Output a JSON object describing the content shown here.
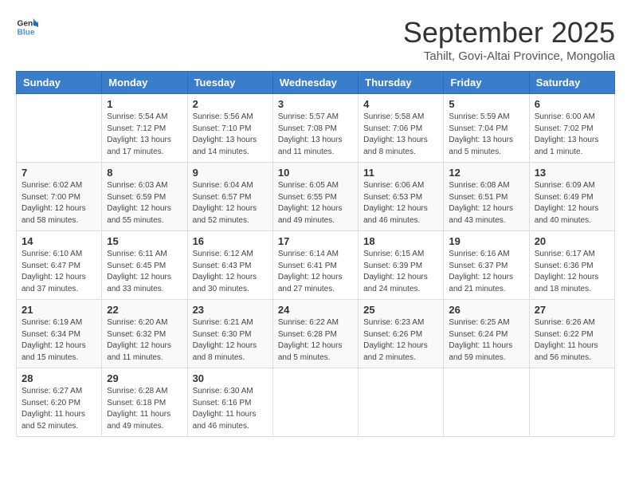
{
  "header": {
    "logo": {
      "general": "General",
      "blue": "Blue"
    },
    "title": "September 2025",
    "subtitle": "Tahilt, Govi-Altai Province, Mongolia"
  },
  "calendar": {
    "days_of_week": [
      "Sunday",
      "Monday",
      "Tuesday",
      "Wednesday",
      "Thursday",
      "Friday",
      "Saturday"
    ],
    "weeks": [
      [
        {
          "day": "",
          "info": ""
        },
        {
          "day": "1",
          "info": "Sunrise: 5:54 AM\nSunset: 7:12 PM\nDaylight: 13 hours\nand 17 minutes."
        },
        {
          "day": "2",
          "info": "Sunrise: 5:56 AM\nSunset: 7:10 PM\nDaylight: 13 hours\nand 14 minutes."
        },
        {
          "day": "3",
          "info": "Sunrise: 5:57 AM\nSunset: 7:08 PM\nDaylight: 13 hours\nand 11 minutes."
        },
        {
          "day": "4",
          "info": "Sunrise: 5:58 AM\nSunset: 7:06 PM\nDaylight: 13 hours\nand 8 minutes."
        },
        {
          "day": "5",
          "info": "Sunrise: 5:59 AM\nSunset: 7:04 PM\nDaylight: 13 hours\nand 5 minutes."
        },
        {
          "day": "6",
          "info": "Sunrise: 6:00 AM\nSunset: 7:02 PM\nDaylight: 13 hours\nand 1 minute."
        }
      ],
      [
        {
          "day": "7",
          "info": "Sunrise: 6:02 AM\nSunset: 7:00 PM\nDaylight: 12 hours\nand 58 minutes."
        },
        {
          "day": "8",
          "info": "Sunrise: 6:03 AM\nSunset: 6:59 PM\nDaylight: 12 hours\nand 55 minutes."
        },
        {
          "day": "9",
          "info": "Sunrise: 6:04 AM\nSunset: 6:57 PM\nDaylight: 12 hours\nand 52 minutes."
        },
        {
          "day": "10",
          "info": "Sunrise: 6:05 AM\nSunset: 6:55 PM\nDaylight: 12 hours\nand 49 minutes."
        },
        {
          "day": "11",
          "info": "Sunrise: 6:06 AM\nSunset: 6:53 PM\nDaylight: 12 hours\nand 46 minutes."
        },
        {
          "day": "12",
          "info": "Sunrise: 6:08 AM\nSunset: 6:51 PM\nDaylight: 12 hours\nand 43 minutes."
        },
        {
          "day": "13",
          "info": "Sunrise: 6:09 AM\nSunset: 6:49 PM\nDaylight: 12 hours\nand 40 minutes."
        }
      ],
      [
        {
          "day": "14",
          "info": "Sunrise: 6:10 AM\nSunset: 6:47 PM\nDaylight: 12 hours\nand 37 minutes."
        },
        {
          "day": "15",
          "info": "Sunrise: 6:11 AM\nSunset: 6:45 PM\nDaylight: 12 hours\nand 33 minutes."
        },
        {
          "day": "16",
          "info": "Sunrise: 6:12 AM\nSunset: 6:43 PM\nDaylight: 12 hours\nand 30 minutes."
        },
        {
          "day": "17",
          "info": "Sunrise: 6:14 AM\nSunset: 6:41 PM\nDaylight: 12 hours\nand 27 minutes."
        },
        {
          "day": "18",
          "info": "Sunrise: 6:15 AM\nSunset: 6:39 PM\nDaylight: 12 hours\nand 24 minutes."
        },
        {
          "day": "19",
          "info": "Sunrise: 6:16 AM\nSunset: 6:37 PM\nDaylight: 12 hours\nand 21 minutes."
        },
        {
          "day": "20",
          "info": "Sunrise: 6:17 AM\nSunset: 6:36 PM\nDaylight: 12 hours\nand 18 minutes."
        }
      ],
      [
        {
          "day": "21",
          "info": "Sunrise: 6:19 AM\nSunset: 6:34 PM\nDaylight: 12 hours\nand 15 minutes."
        },
        {
          "day": "22",
          "info": "Sunrise: 6:20 AM\nSunset: 6:32 PM\nDaylight: 12 hours\nand 11 minutes."
        },
        {
          "day": "23",
          "info": "Sunrise: 6:21 AM\nSunset: 6:30 PM\nDaylight: 12 hours\nand 8 minutes."
        },
        {
          "day": "24",
          "info": "Sunrise: 6:22 AM\nSunset: 6:28 PM\nDaylight: 12 hours\nand 5 minutes."
        },
        {
          "day": "25",
          "info": "Sunrise: 6:23 AM\nSunset: 6:26 PM\nDaylight: 12 hours\nand 2 minutes."
        },
        {
          "day": "26",
          "info": "Sunrise: 6:25 AM\nSunset: 6:24 PM\nDaylight: 11 hours\nand 59 minutes."
        },
        {
          "day": "27",
          "info": "Sunrise: 6:26 AM\nSunset: 6:22 PM\nDaylight: 11 hours\nand 56 minutes."
        }
      ],
      [
        {
          "day": "28",
          "info": "Sunrise: 6:27 AM\nSunset: 6:20 PM\nDaylight: 11 hours\nand 52 minutes."
        },
        {
          "day": "29",
          "info": "Sunrise: 6:28 AM\nSunset: 6:18 PM\nDaylight: 11 hours\nand 49 minutes."
        },
        {
          "day": "30",
          "info": "Sunrise: 6:30 AM\nSunset: 6:16 PM\nDaylight: 11 hours\nand 46 minutes."
        },
        {
          "day": "",
          "info": ""
        },
        {
          "day": "",
          "info": ""
        },
        {
          "day": "",
          "info": ""
        },
        {
          "day": "",
          "info": ""
        }
      ]
    ]
  }
}
